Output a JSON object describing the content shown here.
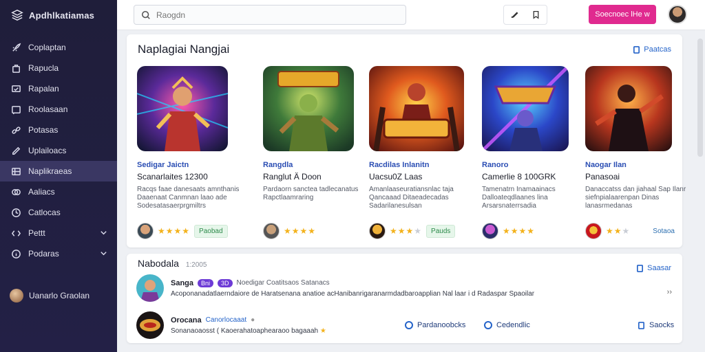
{
  "app": {
    "title": "Apdhlkatiamas"
  },
  "sidebar": {
    "items": [
      {
        "label": "Coplaptan",
        "icon": "rocket-icon"
      },
      {
        "label": "Rapucla",
        "icon": "bag-icon"
      },
      {
        "label": "Rapalan",
        "icon": "monitor-icon"
      },
      {
        "label": "Roolasaan",
        "icon": "video-icon"
      },
      {
        "label": "Potasas",
        "icon": "link-icon"
      },
      {
        "label": "Uplailoacs",
        "icon": "edit-icon"
      },
      {
        "label": "Naplikraeas",
        "icon": "grid-icon"
      },
      {
        "label": "Aaliacs",
        "icon": "rings-icon"
      },
      {
        "label": "Catlocas",
        "icon": "clock-icon"
      },
      {
        "label": "Pettt",
        "icon": "code-icon"
      },
      {
        "label": "Podaras",
        "icon": "info-icon"
      }
    ],
    "active_index": 6,
    "user": "Uanarlo Graolan"
  },
  "topbar": {
    "search_placeholder": "Raogdn",
    "cta_label": "Soecnoec lHe  w"
  },
  "featured": {
    "title": "Naplagiai Nangjai",
    "see_all": "Paatcas",
    "cards": [
      {
        "title": "Sedigar Jaictn",
        "subtitle": "Scanarlaites 12300",
        "desc": "Racqs faae danesaats amnthanis Daaenaat Canmnan laao ade Sodesatasaerprgmiltrs",
        "rating": 4,
        "action": "Paobad",
        "action_type": "pill"
      },
      {
        "title": "Rangdla",
        "subtitle": "Ranglut Ä Doon",
        "desc": "Pardaorn sanctea tadlecanatus Rapctlaamraring",
        "rating": 4,
        "action": "",
        "action_type": "none"
      },
      {
        "title": "Racdilas Inlanitn",
        "subtitle": "Uacsu0Z  Laas",
        "desc": "Amanlaaseuratiansnlac taja Qancaaad Ditaeadecadas Sadarilanesulsan",
        "rating": 2.5,
        "action": "Pauds",
        "action_type": "pill"
      },
      {
        "title": "Ranoro",
        "subtitle": "Camerlie  8 100GRK",
        "desc": "Tamenatrn  Inamaainacs Dalloateqdlaanes lina Arsarsnaterrsadia",
        "rating": 3.5,
        "action": "",
        "action_type": "none"
      },
      {
        "title": "Naogar Ilan",
        "subtitle": "Panasoai",
        "desc": "Danaccatss dan jiahaal Sap Ilanr  siefnpialaarenpan Dinas lanasrmedanas",
        "rating": 2.5,
        "action": "Sotaoa",
        "action_type": "link"
      }
    ]
  },
  "recent": {
    "title": "Nabodala",
    "count": "1:2005",
    "see_all": "Saasar",
    "rows": [
      {
        "name": "Sanga",
        "tag1": "Bni",
        "tag2": "3D",
        "meta": "Noedigar Coatitsaos Satanacs",
        "text": "Acoponanadatlaerndaiore de Haratsenana  anatioe acHanibanrigaranarmdadbaroapplian Nal laar i d Radaspar Spaoilar"
      },
      {
        "name": "Orocana",
        "link": "Canorlocaaat",
        "meta": "",
        "text": "Sonanaoaosst  ( Kaoerahatoaphearaoo bagaaah",
        "action_a": "Pardanoobcks",
        "action_b": "Cedendlic",
        "action_c": "Saocks"
      }
    ]
  }
}
